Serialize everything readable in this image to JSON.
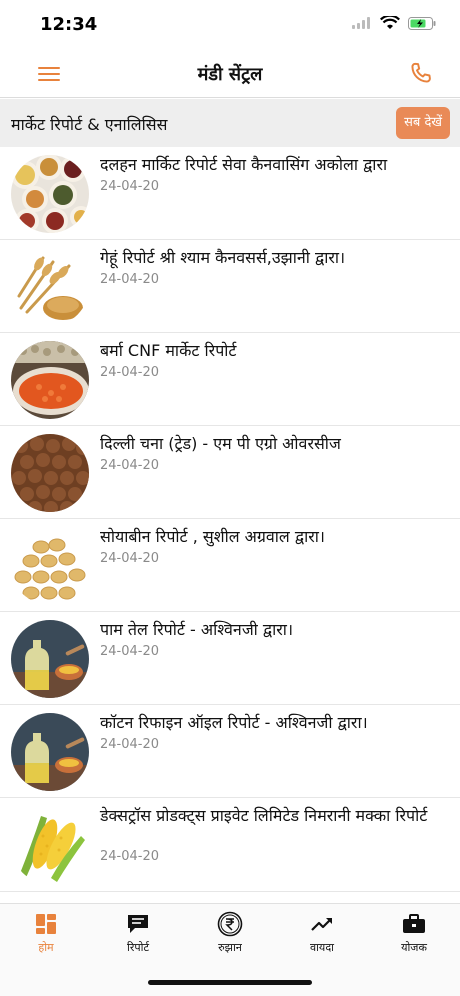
{
  "status": {
    "time": "12:34"
  },
  "header": {
    "title": "मंडी सेंट्रल"
  },
  "section": {
    "title": "मार्केट रिपोर्ट & एनालिसिस",
    "see_all": "सब देखें"
  },
  "items": [
    {
      "title": "दलहन मार्किट रिपोर्ट सेवा कैनवासिंग अकोला द्वारा",
      "date": "24-04-20",
      "thumb": "pulses"
    },
    {
      "title": "गेहूं रिपोर्ट श्री श्याम कैनवसर्स,उझानी द्वारा।",
      "date": "24-04-20",
      "thumb": "wheat"
    },
    {
      "title": "बर्मा CNF मार्केट रिपोर्ट",
      "date": "24-04-20",
      "thumb": "lentils"
    },
    {
      "title": "दिल्ली चना (ट्रेड) - एम पी एग्रो ओवरसीज",
      "date": "24-04-20",
      "thumb": "chana"
    },
    {
      "title": "सोयाबीन रिपोर्ट , सुशील अग्रवाल द्वारा।",
      "date": "24-04-20",
      "thumb": "soybean"
    },
    {
      "title": "पाम तेल रिपोर्ट - अश्विनजी द्वारा।",
      "date": "24-04-20",
      "thumb": "oil"
    },
    {
      "title": "कॉटन रिफाइन ऑइल रिपोर्ट - अश्विनजी द्वारा।",
      "date": "24-04-20",
      "thumb": "oil"
    },
    {
      "title": "डेक्सट्रॉस प्रोडक्ट्स प्राइवेट लिमिटेड निमरानी मक्का रिपोर्ट",
      "date": "24-04-20",
      "thumb": "corn"
    }
  ],
  "tabs": [
    {
      "label": "होम",
      "icon": "home-grid-icon",
      "active": true
    },
    {
      "label": "रिपोर्ट",
      "icon": "report-chat-icon",
      "active": false
    },
    {
      "label": "रुझान",
      "icon": "rupee-icon",
      "active": false
    },
    {
      "label": "वायदा",
      "icon": "trend-up-icon",
      "active": false
    },
    {
      "label": "योजक",
      "icon": "briefcase-icon",
      "active": false
    }
  ],
  "colors": {
    "accent": "#e8823c",
    "button": "#e98a57",
    "section_bg": "#eeeeee"
  }
}
